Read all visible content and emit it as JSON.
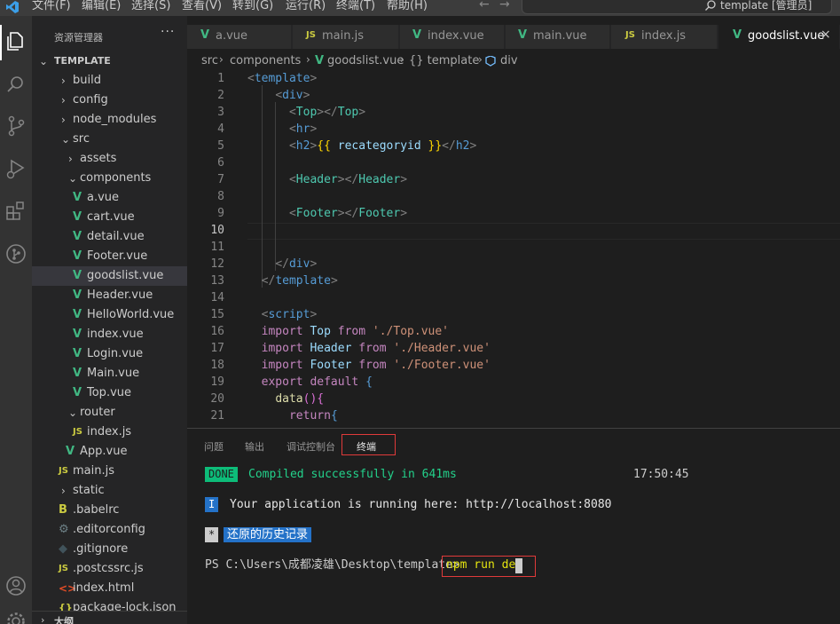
{
  "menubar": {
    "items": [
      "文件(F)",
      "编辑(E)",
      "选择(S)",
      "查看(V)",
      "转到(G)",
      "运行(R)",
      "终端(T)",
      "帮助(H)"
    ],
    "search_label": "template [管理员]",
    "back_glyph": "←",
    "forward_glyph": "→"
  },
  "activity_icons": [
    "explorer-icon",
    "search-icon",
    "source-control-icon",
    "run-debug-icon",
    "extensions-icon",
    "git-graph-icon",
    "account-icon",
    "settings-icon"
  ],
  "sidebar": {
    "title": "资源管理器",
    "more": "···",
    "root": "TEMPLATE",
    "items": [
      {
        "label": "build",
        "kind": "folder",
        "open": false
      },
      {
        "label": "config",
        "kind": "folder",
        "open": false
      },
      {
        "label": "node_modules",
        "kind": "folder",
        "open": false
      },
      {
        "label": "src",
        "kind": "folder",
        "open": true
      },
      {
        "label": "assets",
        "kind": "folder",
        "open": false
      },
      {
        "label": "components",
        "kind": "folder",
        "open": true
      },
      {
        "label": "a.vue",
        "kind": "vue"
      },
      {
        "label": "cart.vue",
        "kind": "vue"
      },
      {
        "label": "detail.vue",
        "kind": "vue"
      },
      {
        "label": "Footer.vue",
        "kind": "vue"
      },
      {
        "label": "goodslist.vue",
        "kind": "vue",
        "selected": true
      },
      {
        "label": "Header.vue",
        "kind": "vue"
      },
      {
        "label": "HelloWorld.vue",
        "kind": "vue"
      },
      {
        "label": "index.vue",
        "kind": "vue"
      },
      {
        "label": "Login.vue",
        "kind": "vue"
      },
      {
        "label": "Main.vue",
        "kind": "vue"
      },
      {
        "label": "Top.vue",
        "kind": "vue"
      },
      {
        "label": "router",
        "kind": "folder",
        "open": true
      },
      {
        "label": "index.js",
        "kind": "js"
      },
      {
        "label": "App.vue",
        "kind": "vue"
      },
      {
        "label": "main.js",
        "kind": "js"
      },
      {
        "label": "static",
        "kind": "folder",
        "open": false
      },
      {
        "label": ".babelrc",
        "kind": "babel"
      },
      {
        "label": ".editorconfig",
        "kind": "gear"
      },
      {
        "label": ".gitignore",
        "kind": "git"
      },
      {
        "label": ".postcssrc.js",
        "kind": "js"
      },
      {
        "label": "index.html",
        "kind": "html"
      },
      {
        "label": "package-lock.json",
        "kind": "json"
      }
    ],
    "outline_label": "大纲"
  },
  "tabs": [
    {
      "label": "a.vue",
      "kind": "vue"
    },
    {
      "label": "main.js",
      "kind": "js"
    },
    {
      "label": "index.vue",
      "kind": "vue"
    },
    {
      "label": "main.vue",
      "kind": "vue"
    },
    {
      "label": "index.js",
      "kind": "js"
    },
    {
      "label": "goodslist.vue",
      "kind": "vue",
      "active": true,
      "close": "×"
    }
  ],
  "breadcrumb": [
    "src",
    "components",
    "goodslist.vue",
    "{} template",
    "div"
  ],
  "editor": {
    "current_line": 10,
    "lines": [
      [
        [
          "t-tag",
          "<"
        ],
        [
          "t-name",
          "template"
        ],
        [
          "t-tag",
          ">"
        ]
      ],
      [
        [
          "",
          "    "
        ],
        [
          "t-tag",
          "<"
        ],
        [
          "t-name",
          "div"
        ],
        [
          "t-tag",
          ">"
        ]
      ],
      [
        [
          "",
          "      "
        ],
        [
          "t-tag",
          "<"
        ],
        [
          "t-comp",
          "Top"
        ],
        [
          "t-tag",
          "></"
        ],
        [
          "t-comp",
          "Top"
        ],
        [
          "t-tag",
          ">"
        ]
      ],
      [
        [
          "",
          "      "
        ],
        [
          "t-tag",
          "<"
        ],
        [
          "t-name",
          "hr"
        ],
        [
          "t-tag",
          ">"
        ]
      ],
      [
        [
          "",
          "      "
        ],
        [
          "t-tag",
          "<"
        ],
        [
          "t-name",
          "h2"
        ],
        [
          "t-tag",
          ">"
        ],
        [
          "t-brace",
          "{{ "
        ],
        [
          "t-var",
          "recategoryid"
        ],
        [
          "t-brace",
          " }}"
        ],
        [
          "t-tag",
          "</"
        ],
        [
          "t-name",
          "h2"
        ],
        [
          "t-tag",
          ">"
        ]
      ],
      [],
      [
        [
          "",
          "      "
        ],
        [
          "t-tag",
          "<"
        ],
        [
          "t-comp",
          "Header"
        ],
        [
          "t-tag",
          "></"
        ],
        [
          "t-comp",
          "Header"
        ],
        [
          "t-tag",
          ">"
        ]
      ],
      [],
      [
        [
          "",
          "      "
        ],
        [
          "t-tag",
          "<"
        ],
        [
          "t-comp",
          "Footer"
        ],
        [
          "t-tag",
          "></"
        ],
        [
          "t-comp",
          "Footer"
        ],
        [
          "t-tag",
          ">"
        ]
      ],
      [],
      [],
      [
        [
          "",
          "    "
        ],
        [
          "t-tag",
          "</"
        ],
        [
          "t-name",
          "div"
        ],
        [
          "t-tag",
          ">"
        ]
      ],
      [
        [
          "",
          "  "
        ],
        [
          "t-tag",
          "</"
        ],
        [
          "t-name",
          "template"
        ],
        [
          "t-tag",
          ">"
        ]
      ],
      [],
      [
        [
          "",
          "  "
        ],
        [
          "t-tag",
          "<"
        ],
        [
          "t-name",
          "script"
        ],
        [
          "t-tag",
          ">"
        ]
      ],
      [
        [
          "",
          "  "
        ],
        [
          "t-kw",
          "import"
        ],
        [
          "",
          " "
        ],
        [
          "t-var",
          "Top"
        ],
        [
          "",
          " "
        ],
        [
          "t-kw",
          "from"
        ],
        [
          "",
          " "
        ],
        [
          "t-str",
          "'./Top.vue'"
        ]
      ],
      [
        [
          "",
          "  "
        ],
        [
          "t-kw",
          "import"
        ],
        [
          "",
          " "
        ],
        [
          "t-var",
          "Header"
        ],
        [
          "",
          " "
        ],
        [
          "t-kw",
          "from"
        ],
        [
          "",
          " "
        ],
        [
          "t-str",
          "'./Header.vue'"
        ]
      ],
      [
        [
          "",
          "  "
        ],
        [
          "t-kw",
          "import"
        ],
        [
          "",
          " "
        ],
        [
          "t-var",
          "Footer"
        ],
        [
          "",
          " "
        ],
        [
          "t-kw",
          "from"
        ],
        [
          "",
          " "
        ],
        [
          "t-str",
          "'./Footer.vue'"
        ]
      ],
      [
        [
          "",
          "  "
        ],
        [
          "t-kw",
          "export"
        ],
        [
          "",
          " "
        ],
        [
          "t-kw",
          "default"
        ],
        [
          "",
          " "
        ],
        [
          "t-kw2",
          "{"
        ]
      ],
      [
        [
          "",
          "    "
        ],
        [
          "t-fn",
          "data"
        ],
        [
          "t-bracket",
          "()"
        ],
        [
          "t-bracket",
          "{"
        ]
      ],
      [
        [
          "",
          "      "
        ],
        [
          "t-kw",
          "return"
        ],
        [
          "t-kw2",
          "{"
        ]
      ]
    ]
  },
  "panel": {
    "tabs": [
      "问题",
      "输出",
      "调试控制台",
      "终端"
    ],
    "active_tab": "终端",
    "done_badge": "DONE",
    "done_text": "Compiled successfully in 641ms",
    "time": "17:50:45",
    "info_badge": "I",
    "info_text": "Your application is running here: http://localhost:8080",
    "history_star": "*",
    "history_text": "还原的历史记录",
    "prompt": "PS C:\\Users\\成都凌雄\\Desktop\\template>",
    "command": "npm run dev"
  },
  "colors": {
    "accent_vue": "#41b883",
    "accent_js": "#cbcb41",
    "highlight_box": "#e03a3a",
    "done_bg": "#0dbc79",
    "info_bg": "#2472c8"
  }
}
